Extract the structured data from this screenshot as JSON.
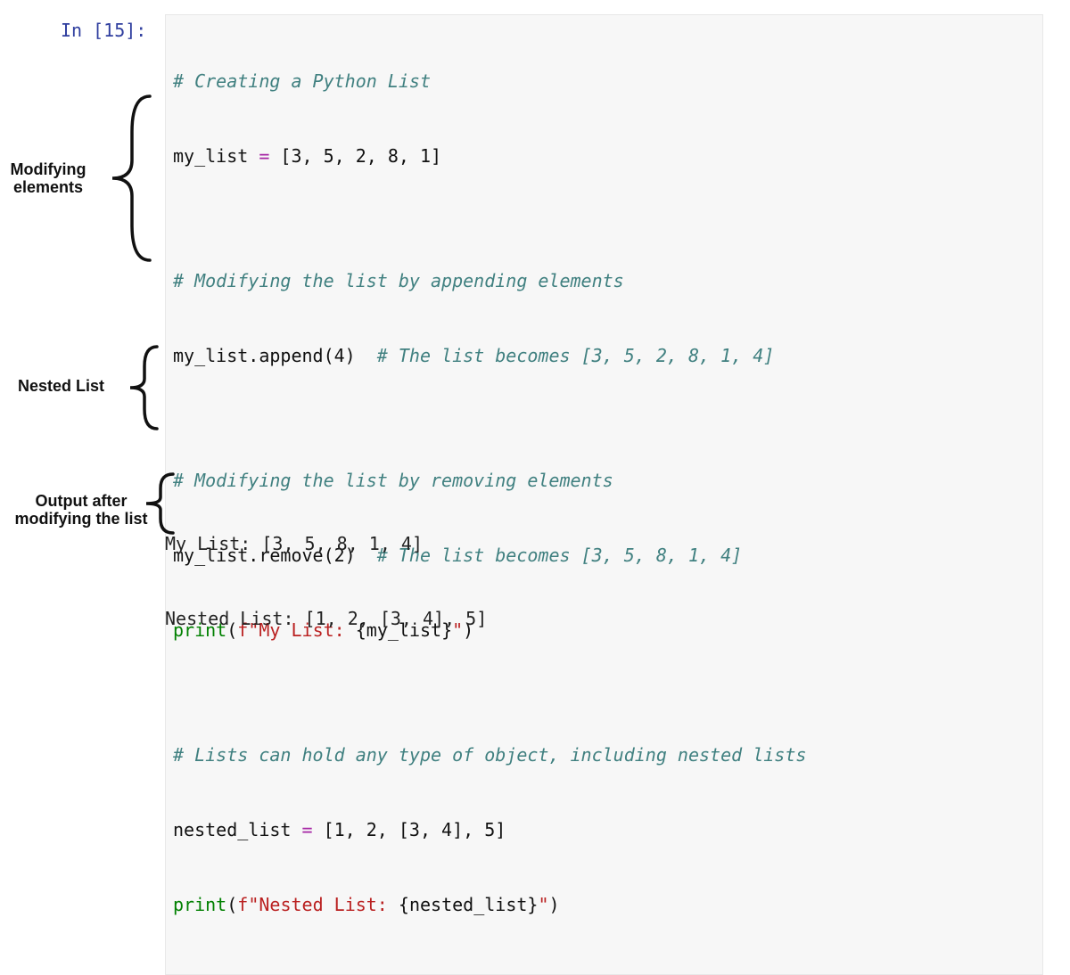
{
  "prompt": {
    "label": "In [15]:",
    "execution_count": 15
  },
  "code": {
    "l1": {
      "comment": "# Creating a Python List"
    },
    "l2": {
      "var": "my_list",
      "op": " = ",
      "lit": "[3, 5, 2, 8, 1]"
    },
    "l3": {
      "blank": ""
    },
    "l4": {
      "comment": "# Modifying the list by appending elements"
    },
    "l5": {
      "call": "my_list.append(4)",
      "pad": "  ",
      "comment": "# The list becomes [3, 5, 2, 8, 1, 4]"
    },
    "l6": {
      "blank": ""
    },
    "l7": {
      "comment": "# Modifying the list by removing elements"
    },
    "l8": {
      "call": "my_list.remove(2)",
      "pad": "  ",
      "comment": "# The list becomes [3, 5, 8, 1, 4]"
    },
    "l9": {
      "func": "print",
      "paren_open": "(",
      "prefix": "f",
      "str_open": "\"",
      "str_a": "My List: ",
      "interp": "{my_list}",
      "str_close": "\"",
      "paren_close": ")"
    },
    "l10": {
      "blank": ""
    },
    "l11": {
      "comment": "# Lists can hold any type of object, including nested lists"
    },
    "l12": {
      "var": "nested_list",
      "op": " = ",
      "lit": "[1, 2, [3, 4], 5]"
    },
    "l13": {
      "func": "print",
      "paren_open": "(",
      "prefix": "f",
      "str_open": "\"",
      "str_a": "Nested List: ",
      "interp": "{nested_list}",
      "str_close": "\"",
      "paren_close": ")"
    }
  },
  "output": {
    "line1": "My List: [3, 5, 8, 1, 4]",
    "line2": "Nested List: [1, 2, [3, 4], 5]"
  },
  "annotations": {
    "modifying": "Modifying\nelements",
    "nested": "Nested List",
    "output": "Output after\nmodifying the list"
  }
}
